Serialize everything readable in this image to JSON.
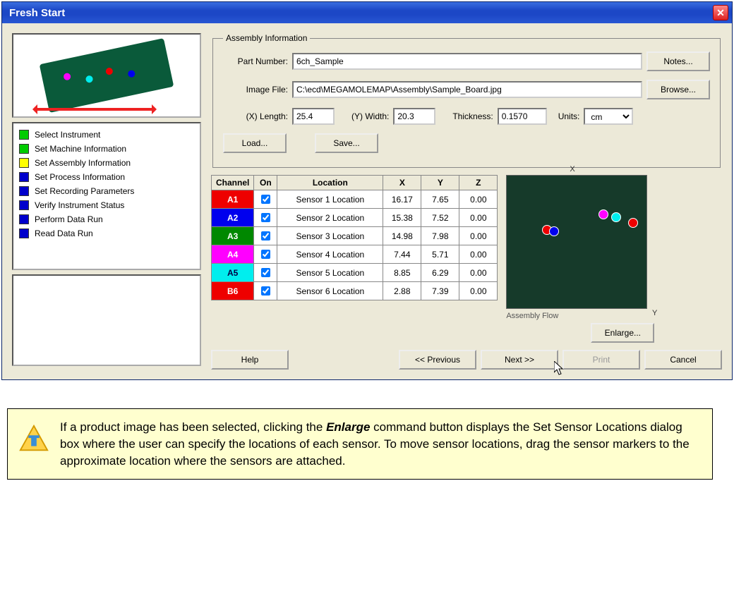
{
  "title": "Fresh Start",
  "steps": [
    {
      "color": "green",
      "label": "Select Instrument"
    },
    {
      "color": "green",
      "label": "Set Machine Information"
    },
    {
      "color": "yellow",
      "label": "Set Assembly Information"
    },
    {
      "color": "blue",
      "label": "Set Process Information"
    },
    {
      "color": "blue",
      "label": "Set Recording Parameters"
    },
    {
      "color": "blue",
      "label": "Verify Instrument Status"
    },
    {
      "color": "blue",
      "label": "Perform Data Run"
    },
    {
      "color": "blue",
      "label": "Read Data Run"
    }
  ],
  "assembly": {
    "legend": "Assembly Information",
    "part_label": "Part Number:",
    "part_value": "6ch_Sample",
    "notes_btn": "Notes...",
    "image_label": "Image File:",
    "image_value": "C:\\ecd\\MEGAMOLEMAP\\Assembly\\Sample_Board.jpg",
    "browse_btn": "Browse...",
    "xlength_label": "(X) Length:",
    "xlength_value": "25.4",
    "ywidth_label": "(Y) Width:",
    "ywidth_value": "20.3",
    "thickness_label": "Thickness:",
    "thickness_value": "0.1570",
    "units_label": "Units:",
    "units_value": "cm",
    "load_btn": "Load...",
    "save_btn": "Save..."
  },
  "table": {
    "headers": {
      "channel": "Channel",
      "on": "On",
      "location": "Location",
      "x": "X",
      "y": "Y",
      "z": "Z"
    },
    "rows": [
      {
        "ch": "A1",
        "cls": "ch-red",
        "on": true,
        "loc": "Sensor 1 Location",
        "x": "16.17",
        "y": "7.65",
        "z": "0.00"
      },
      {
        "ch": "A2",
        "cls": "ch-blue",
        "on": true,
        "loc": "Sensor 2 Location",
        "x": "15.38",
        "y": "7.52",
        "z": "0.00"
      },
      {
        "ch": "A3",
        "cls": "ch-green",
        "on": true,
        "loc": "Sensor 3 Location",
        "x": "14.98",
        "y": "7.98",
        "z": "0.00"
      },
      {
        "ch": "A4",
        "cls": "ch-magenta",
        "on": true,
        "loc": "Sensor 4 Location",
        "x": "7.44",
        "y": "5.71",
        "z": "0.00"
      },
      {
        "ch": "A5",
        "cls": "ch-cyan",
        "on": true,
        "loc": "Sensor 5 Location",
        "x": "8.85",
        "y": "6.29",
        "z": "0.00"
      },
      {
        "ch": "B6",
        "cls": "ch-red",
        "on": true,
        "loc": "Sensor 6 Location",
        "x": "2.88",
        "y": "7.39",
        "z": "0.00"
      }
    ]
  },
  "board": {
    "flow_label": "Assembly Flow",
    "enlarge_btn": "Enlarge..."
  },
  "footer": {
    "help": "Help",
    "prev": "<< Previous",
    "next": "Next >>",
    "print": "Print",
    "cancel": "Cancel"
  },
  "tip": {
    "text_1": "If a product image has been selected, clicking the ",
    "bold": "Enlarge",
    "text_2": " command button displays the Set Sensor Locations dialog box where the user can specify the locations of each sensor. To move sensor locations, drag the sensor markers to the approximate location where the sensors are attached."
  }
}
